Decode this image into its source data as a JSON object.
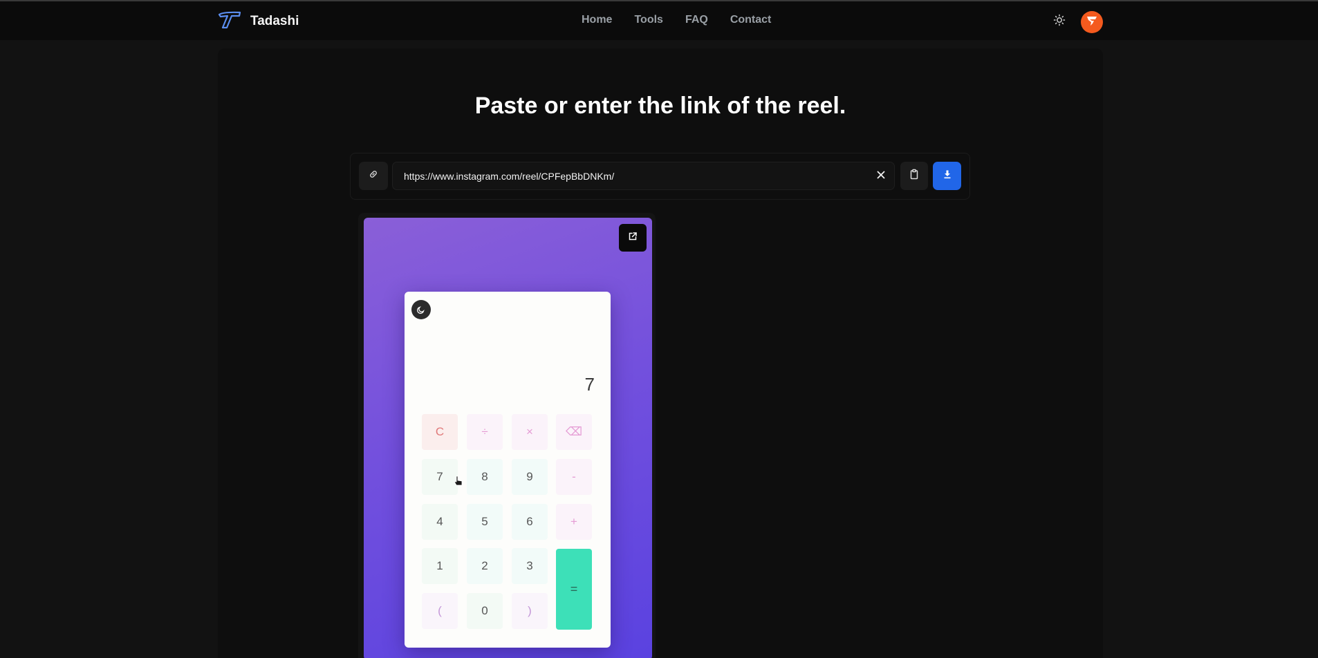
{
  "brand": {
    "name": "Tadashi",
    "logo_icon": "tadashi-logo-icon"
  },
  "nav": {
    "links": [
      "Home",
      "Tools",
      "FAQ",
      "Contact"
    ]
  },
  "header_icons": {
    "theme": "sun-icon",
    "avatar": "flame-avatar-icon"
  },
  "main": {
    "headline": "Paste or enter the link of the reel.",
    "url_value": "https://www.instagram.com/reel/CPFepBbDNKm/",
    "link_icon": "link-icon",
    "clear_icon": "close-icon",
    "paste_icon": "clipboard-icon",
    "download_icon": "download-icon"
  },
  "preview": {
    "open_icon": "external-link-icon",
    "calculator": {
      "display": "7",
      "keys": {
        "clear": "C",
        "divide": "÷",
        "multiply": "×",
        "backspace": "⌫",
        "seven": "7",
        "eight": "8",
        "nine": "9",
        "minus": "-",
        "four": "4",
        "five": "5",
        "six": "6",
        "plus": "+",
        "one": "1",
        "two": "2",
        "three": "3",
        "equals": "=",
        "open_paren": "(",
        "zero": "0",
        "close_paren": ")"
      }
    }
  },
  "colors": {
    "background": "#121212",
    "navbar": "#0b0b0b",
    "accent": "#2166e8",
    "avatar": "#f45a1e",
    "equals_key": "#3de0b8"
  }
}
